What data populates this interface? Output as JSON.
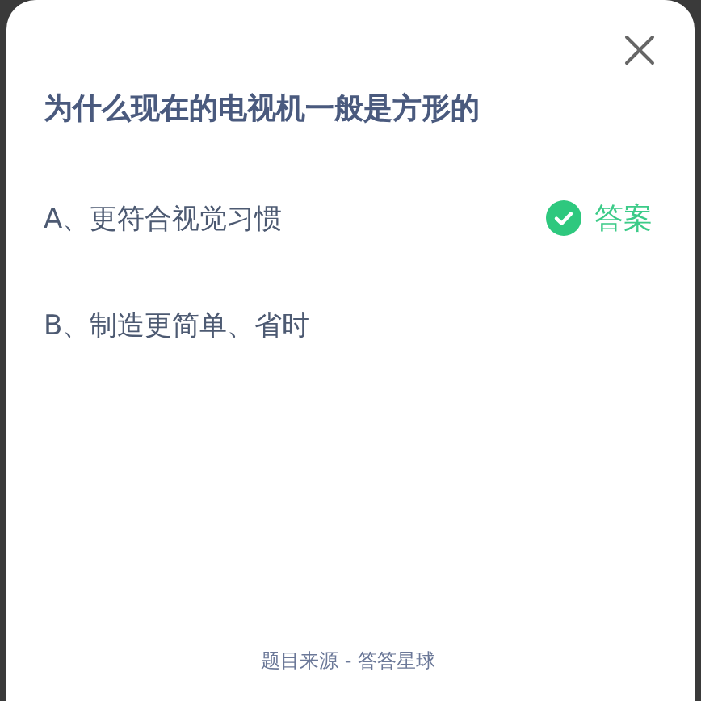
{
  "question": "为什么现在的电视机一般是方形的",
  "answer_label": "答案",
  "options": [
    {
      "text": "A、更符合视觉习惯",
      "correct": true
    },
    {
      "text": "B、制造更简单、省时",
      "correct": false
    }
  ],
  "footer": "题目来源 - 答答星球"
}
